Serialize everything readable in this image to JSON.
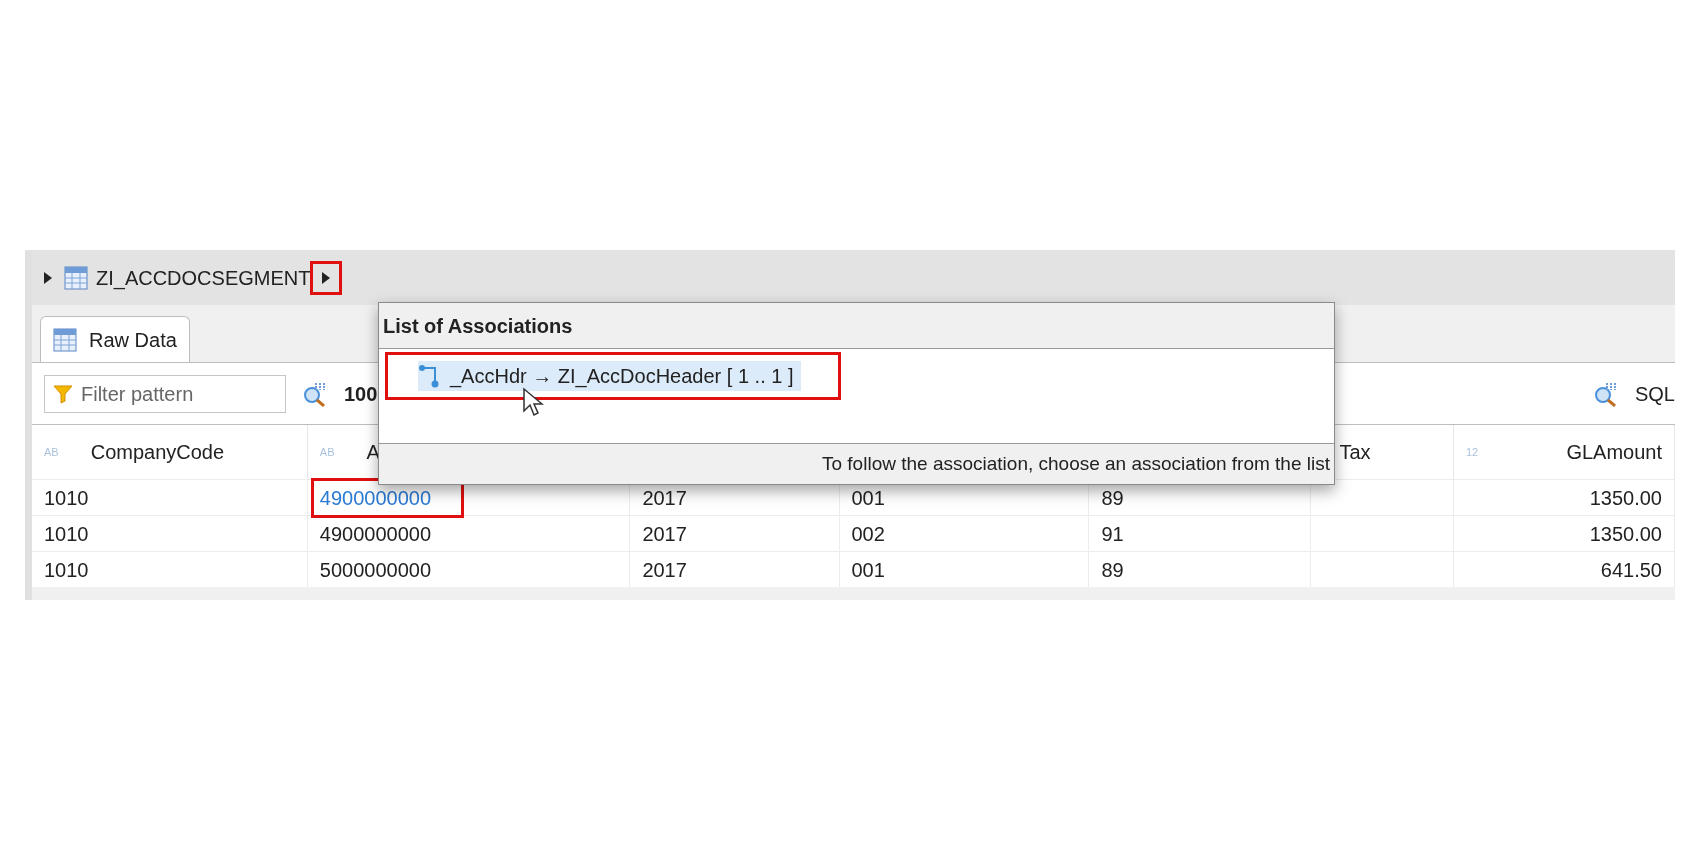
{
  "breadcrumb": {
    "entity": "ZI_ACCDOCSEGMENT",
    "next_highlighted": true
  },
  "tabs": [
    {
      "label": "Raw Data",
      "selected": true
    }
  ],
  "toolbar": {
    "filter_placeholder": "Filter pattern",
    "row_count": "100",
    "sql_label": "SQL"
  },
  "table": {
    "columns": [
      {
        "label": "CompanyCode",
        "type_mark": "AB"
      },
      {
        "label": "A",
        "type_mark": "AB"
      },
      {},
      {},
      {},
      {
        "label": "Tax"
      },
      {
        "label": "GLAmount",
        "type_mark": "12"
      }
    ],
    "rows": [
      {
        "cells": [
          "1010",
          "4900000000",
          "2017",
          "001",
          "89",
          null,
          "1350.00"
        ],
        "key_link": true
      },
      {
        "cells": [
          "1010",
          "4900000000",
          "2017",
          "002",
          "91",
          null,
          "1350.00"
        ],
        "key_link": false
      },
      {
        "cells": [
          "1010",
          "5000000000",
          "2017",
          "001",
          "89",
          null,
          "641.50"
        ],
        "key_link": false
      }
    ]
  },
  "popup": {
    "title": "List of Associations",
    "items": [
      {
        "name": "_AccHdr",
        "target": "ZI_AccDocHeader [ 1 .. 1 ]",
        "arrow": "→",
        "selected": true,
        "highlighted": true
      }
    ],
    "hint": "To follow the association, choose an association from the list"
  }
}
